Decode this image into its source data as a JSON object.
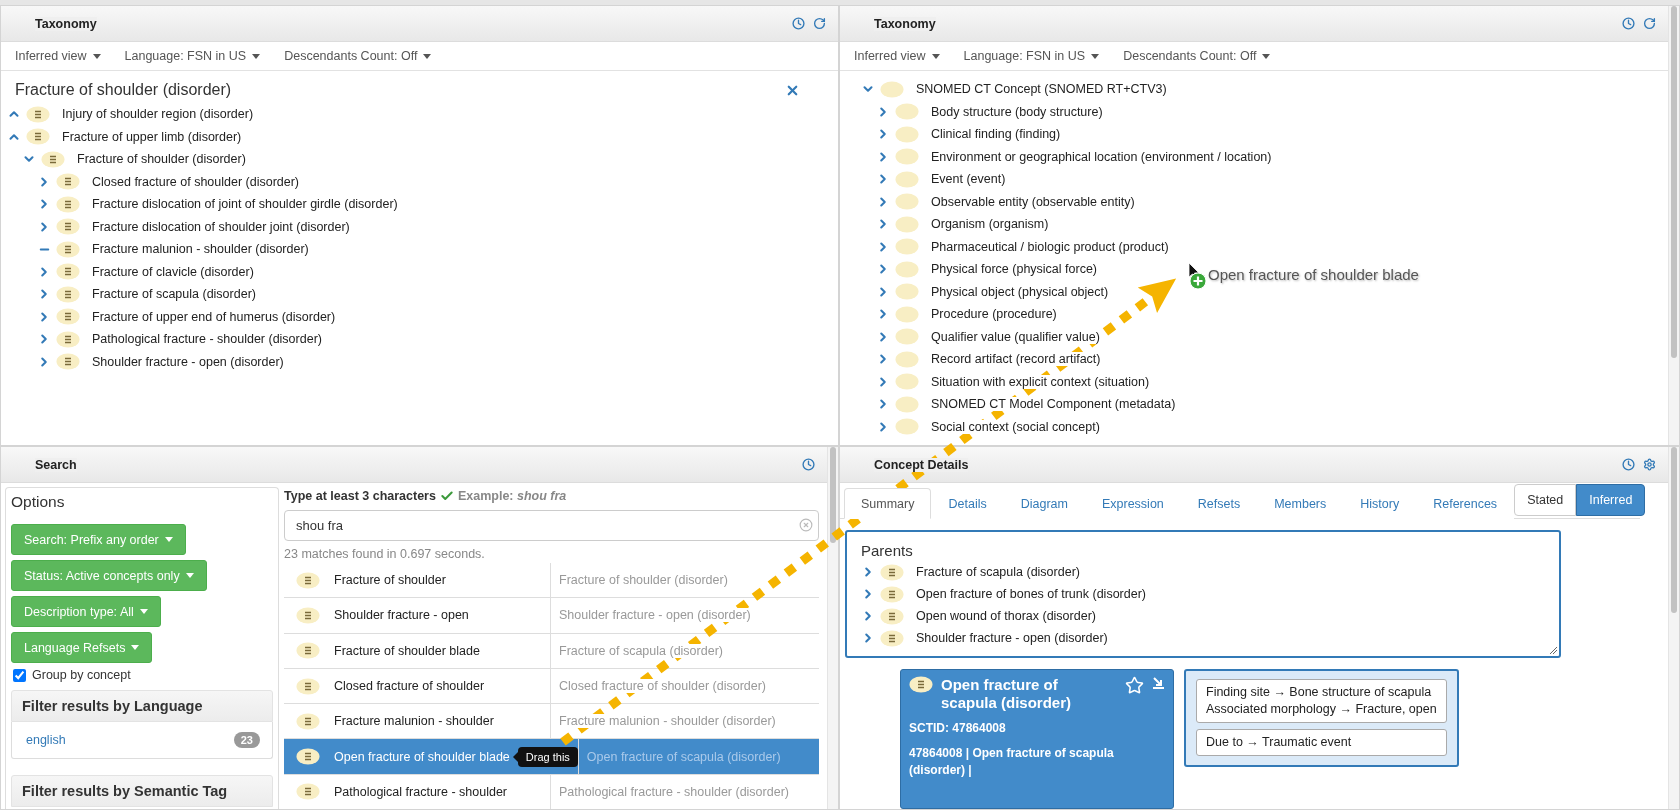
{
  "taxonomy_panels": [
    {
      "title": "Taxonomy",
      "toolbar": [
        "Inferred view",
        "Language: FSN in US",
        "Descendants Count: Off"
      ],
      "focus": "Fracture of shoulder (disorder)",
      "tree": [
        {
          "label": "Injury of shoulder region (disorder)",
          "kind": "ancestor",
          "defined": true
        },
        {
          "label": "Fracture of upper limb (disorder)",
          "kind": "ancestor",
          "defined": true
        },
        {
          "label": "Fracture of shoulder (disorder)",
          "kind": "node",
          "defined": true,
          "expanded": true,
          "leaf": false,
          "children": [
            {
              "label": "Closed fracture of shoulder (disorder)",
              "kind": "node",
              "defined": true,
              "expanded": false,
              "leaf": false
            },
            {
              "label": "Fracture dislocation of joint of shoulder girdle (disorder)",
              "kind": "node",
              "defined": true,
              "expanded": false,
              "leaf": false
            },
            {
              "label": "Fracture dislocation of shoulder joint (disorder)",
              "kind": "node",
              "defined": true,
              "expanded": false,
              "leaf": false
            },
            {
              "label": "Fracture malunion - shoulder (disorder)",
              "kind": "node",
              "defined": true,
              "expanded": false,
              "leaf": true
            },
            {
              "label": "Fracture of clavicle (disorder)",
              "kind": "node",
              "defined": true,
              "expanded": false,
              "leaf": false
            },
            {
              "label": "Fracture of scapula (disorder)",
              "kind": "node",
              "defined": true,
              "expanded": false,
              "leaf": false
            },
            {
              "label": "Fracture of upper end of humerus (disorder)",
              "kind": "node",
              "defined": true,
              "expanded": false,
              "leaf": false
            },
            {
              "label": "Pathological fracture - shoulder (disorder)",
              "kind": "node",
              "defined": true,
              "expanded": false,
              "leaf": false
            },
            {
              "label": "Shoulder fracture - open (disorder)",
              "kind": "node",
              "defined": true,
              "expanded": false,
              "leaf": false
            }
          ]
        }
      ]
    },
    {
      "title": "Taxonomy",
      "toolbar": [
        "Inferred view",
        "Language: FSN in US",
        "Descendants Count: Off"
      ],
      "tree": [
        {
          "label": "SNOMED CT Concept (SNOMED RT+CTV3)",
          "kind": "node",
          "defined": false,
          "expanded": true,
          "leaf": false,
          "children": [
            {
              "label": "Body structure (body structure)",
              "kind": "node",
              "defined": false,
              "expanded": false,
              "leaf": false
            },
            {
              "label": "Clinical finding (finding)",
              "kind": "node",
              "defined": false,
              "expanded": false,
              "leaf": false
            },
            {
              "label": "Environment or geographical location (environment / location)",
              "kind": "node",
              "defined": false,
              "expanded": false,
              "leaf": false
            },
            {
              "label": "Event (event)",
              "kind": "node",
              "defined": false,
              "expanded": false,
              "leaf": false
            },
            {
              "label": "Observable entity (observable entity)",
              "kind": "node",
              "defined": false,
              "expanded": false,
              "leaf": false
            },
            {
              "label": "Organism (organism)",
              "kind": "node",
              "defined": false,
              "expanded": false,
              "leaf": false
            },
            {
              "label": "Pharmaceutical / biologic product (product)",
              "kind": "node",
              "defined": false,
              "expanded": false,
              "leaf": false
            },
            {
              "label": "Physical force (physical force)",
              "kind": "node",
              "defined": false,
              "expanded": false,
              "leaf": false
            },
            {
              "label": "Physical object (physical object)",
              "kind": "node",
              "defined": false,
              "expanded": false,
              "leaf": false
            },
            {
              "label": "Procedure (procedure)",
              "kind": "node",
              "defined": false,
              "expanded": false,
              "leaf": false
            },
            {
              "label": "Qualifier value (qualifier value)",
              "kind": "node",
              "defined": false,
              "expanded": false,
              "leaf": false
            },
            {
              "label": "Record artifact (record artifact)",
              "kind": "node",
              "defined": false,
              "expanded": false,
              "leaf": false
            },
            {
              "label": "Situation with explicit context (situation)",
              "kind": "node",
              "defined": false,
              "expanded": false,
              "leaf": false
            },
            {
              "label": "SNOMED CT Model Component (metadata)",
              "kind": "node",
              "defined": false,
              "expanded": false,
              "leaf": false
            },
            {
              "label": "Social context (social concept)",
              "kind": "node",
              "defined": false,
              "expanded": false,
              "leaf": false
            }
          ]
        }
      ]
    }
  ],
  "search": {
    "title": "Search",
    "options_title": "Options",
    "option_buttons": [
      "Search: Prefix any order",
      "Status: Active concepts only",
      "Description type: All",
      "Language Refsets"
    ],
    "group_by_concept": {
      "label": "Group by concept",
      "checked": true
    },
    "language_filter": {
      "title": "Filter results by Language",
      "items": [
        {
          "label": "english",
          "count": "23"
        }
      ]
    },
    "semantic_filter_title": "Filter results by Semantic Tag",
    "hint": "Type at least 3 characters",
    "example": "Example: *shou fra*",
    "query": "shou fra",
    "summary": "23 matches found in 0.697 seconds.",
    "results": [
      {
        "term": "Fracture of shoulder",
        "fsn": "Fracture of shoulder (disorder)",
        "defined": true,
        "selected": false
      },
      {
        "term": "Shoulder fracture - open",
        "fsn": "Shoulder fracture - open (disorder)",
        "defined": true,
        "selected": false
      },
      {
        "term": "Fracture of shoulder blade",
        "fsn": "Fracture of scapula (disorder)",
        "defined": true,
        "selected": false
      },
      {
        "term": "Closed fracture of shoulder",
        "fsn": "Closed fracture of shoulder (disorder)",
        "defined": true,
        "selected": false
      },
      {
        "term": "Fracture malunion - shoulder",
        "fsn": "Fracture malunion - shoulder (disorder)",
        "defined": true,
        "selected": false
      },
      {
        "term": "Open fracture of shoulder blade",
        "fsn": "Open fracture of scapula (disorder)",
        "defined": true,
        "selected": true
      },
      {
        "term": "Pathological fracture - shoulder",
        "fsn": "Pathological fracture - shoulder (disorder)",
        "defined": true,
        "selected": false
      }
    ],
    "tooltip": "Drag this"
  },
  "details": {
    "title": "Concept Details",
    "tabs": [
      {
        "label": "Summary",
        "selected": true
      },
      {
        "label": "Details",
        "selected": false
      },
      {
        "label": "Diagram",
        "selected": false
      },
      {
        "label": "Expression",
        "selected": false
      },
      {
        "label": "Refsets",
        "selected": false
      },
      {
        "label": "Members",
        "selected": false
      },
      {
        "label": "History",
        "selected": false
      },
      {
        "label": "References",
        "selected": false
      }
    ],
    "views": [
      {
        "label": "Stated",
        "selected": false
      },
      {
        "label": "Inferred",
        "selected": true
      }
    ],
    "parents_title": "Parents",
    "parents": [
      {
        "label": "Fracture of scapula (disorder)",
        "defined": true
      },
      {
        "label": "Open fracture of bones of trunk (disorder)",
        "defined": true
      },
      {
        "label": "Open wound of thorax (disorder)",
        "defined": true
      },
      {
        "label": "Shoulder fracture - open (disorder)",
        "defined": true
      }
    ],
    "concept": {
      "title": "Open fracture of scapula (disorder)",
      "defined": true,
      "sctid": "SCTID: 47864008",
      "expression": "47864008 | Open fracture of scapula (disorder) |"
    },
    "relationship_groups": [
      [
        "Finding site →  Bone structure of scapula",
        "Associated morphology →  Fracture, open"
      ],
      [
        "Due to →  Traumatic event"
      ]
    ]
  },
  "drag": {
    "label": "Open fracture of shoulder blade"
  }
}
